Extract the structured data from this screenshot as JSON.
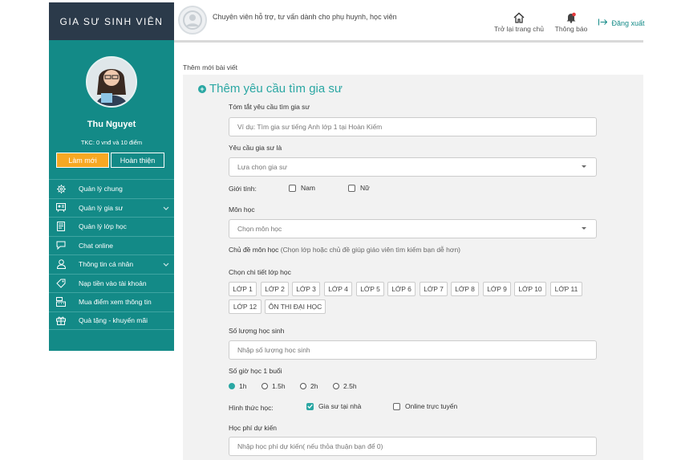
{
  "sidebar": {
    "brand": "GIA SƯ SINH VIÊN",
    "user_name": "Thu Nguyet",
    "balance": "TKC: 0 vnđ và 10 điểm",
    "btn_new": "Làm mới",
    "btn_complete": "Hoàn thiện",
    "items": [
      {
        "label": "Quản lý chung",
        "icon": "gear-icon",
        "expand": false
      },
      {
        "label": "Quản lý gia sư",
        "icon": "tutor-icon",
        "expand": true
      },
      {
        "label": "Quản lý lớp học",
        "icon": "document-icon",
        "expand": false
      },
      {
        "label": "Chat online",
        "icon": "chat-icon",
        "expand": false
      },
      {
        "label": "Thông tin cá nhân",
        "icon": "user-icon",
        "expand": true
      },
      {
        "label": "Nạp tiền vào tài khoản",
        "icon": "tag-icon",
        "expand": false
      },
      {
        "label": "Mua điểm xem thông tin",
        "icon": "cash-register-icon",
        "expand": false
      },
      {
        "label": "Quà tặng - khuyến mãi",
        "icon": "gift-icon",
        "expand": false
      }
    ]
  },
  "header": {
    "tagline": "Chuyên viên hỗ trợ, tư vấn dành cho phụ huynh, học viên",
    "home_label": "Trở lại trang chủ",
    "notify_label": "Thông báo",
    "logout_label": "Đăng xuất"
  },
  "breadcrumb": "Thêm mới bài viết",
  "form": {
    "title": "Thêm yêu cầu tìm gia sư",
    "summary_label": "Tóm tắt yêu cầu tìm gia sư",
    "summary_placeholder": "Ví dụ: Tìm gia sư tiếng Anh lớp 1 tại Hoàn Kiếm",
    "tutor_req_label": "Yêu cầu gia sư là",
    "tutor_req_value": "Lựa chọn gia sư",
    "gender_label": "Giới tính:",
    "gender_male": "Nam",
    "gender_female": "Nữ",
    "subject_label": "Môn học",
    "subject_value": "Chọn môn học",
    "topic_label": "Chủ đề môn học",
    "topic_hint": "(Chọn lớp hoặc chủ đề giúp giáo viên tìm kiếm bạn dễ hơn)",
    "grade_label": "Chọn chi tiết lớp học",
    "grades": [
      "LỚP 1",
      "LỚP 2",
      "LỚP 3",
      "LỚP 4",
      "LỚP 5",
      "LỚP 6",
      "LỚP 7",
      "LỚP 8",
      "LỚP 9",
      "LỚP 10",
      "LỚP 11",
      "LỚP 12",
      "ÔN THI ĐẠI HỌC"
    ],
    "students_label": "Số lượng học sinh",
    "students_placeholder": "Nhập số lượng học sinh",
    "hours_label": "Số giờ học 1 buổi",
    "hours": [
      {
        "label": "1h",
        "selected": true
      },
      {
        "label": "1.5h",
        "selected": false
      },
      {
        "label": "2h",
        "selected": false
      },
      {
        "label": "2.5h",
        "selected": false
      }
    ],
    "mode_label": "Hình thức học:",
    "mode_home": "Gia sư tại nhà",
    "mode_home_checked": true,
    "mode_online": "Online trực tuyến",
    "mode_online_checked": false,
    "fee_label": "Học phí dự kiến",
    "fee_placeholder": "Nhập học phí dự kiến( nếu thỏa thuận bạn để 0)"
  },
  "colors": {
    "accent": "#138a87",
    "title_teal": "#2aa7a3",
    "brand_bg": "#2b3a4a",
    "btn_orange": "#f7a823"
  }
}
